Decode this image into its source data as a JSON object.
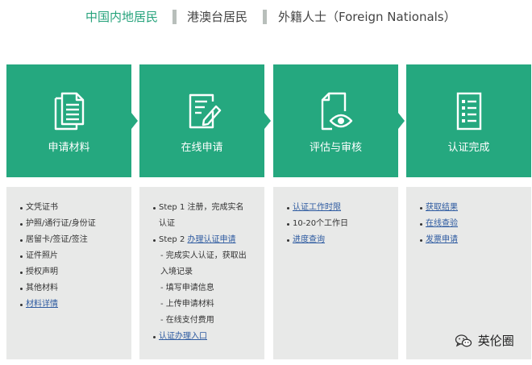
{
  "tabs": [
    {
      "label": "中国内地居民",
      "active": true
    },
    {
      "label": "港澳台居民",
      "active": false
    },
    {
      "label": "外籍人士（Foreign Nationals）",
      "active": false
    }
  ],
  "steps": [
    {
      "title": "申请材料",
      "icon": "documents-icon",
      "items": [
        {
          "text": "文凭证书",
          "type": "bullet"
        },
        {
          "text": "护照/通行证/身份证",
          "type": "bullet"
        },
        {
          "text": "居留卡/签证/签注",
          "type": "bullet"
        },
        {
          "text": "证件照片",
          "type": "bullet"
        },
        {
          "text": "授权声明",
          "type": "bullet"
        },
        {
          "text": "其他材料",
          "type": "bullet"
        },
        {
          "text": "材料详情",
          "type": "bullet",
          "link": true
        }
      ]
    },
    {
      "title": "在线申请",
      "icon": "form-edit-icon",
      "items": [
        {
          "text": "Step 1 注册，完成实名",
          "type": "bullet"
        },
        {
          "text": "认证",
          "type": "cont"
        },
        {
          "text": "Step 2 ",
          "link_text": "办理认证申请",
          "type": "bullet-mixed"
        },
        {
          "text": "- 完成实人认证，获取出",
          "type": "sub"
        },
        {
          "text": "入境记录",
          "type": "sub"
        },
        {
          "text": "- 填写申请信息",
          "type": "sub"
        },
        {
          "text": "- 上传申请材料",
          "type": "sub"
        },
        {
          "text": "- 在线支付费用",
          "type": "sub"
        },
        {
          "text": "认证办理入口",
          "type": "bullet",
          "link": true
        }
      ]
    },
    {
      "title": "评估与审核",
      "icon": "document-eye-icon",
      "items": [
        {
          "text": "认证工作时限",
          "type": "bullet",
          "link": true
        },
        {
          "text": "10-20个工作日",
          "type": "bullet"
        },
        {
          "text": "进度查询",
          "type": "bullet",
          "link": true
        }
      ]
    },
    {
      "title": "认证完成",
      "icon": "checklist-icon",
      "items": [
        {
          "text": "获取结果",
          "type": "bullet",
          "link": true
        },
        {
          "text": "在线查验",
          "type": "bullet",
          "link": true
        },
        {
          "text": "发票申请",
          "type": "bullet",
          "link": true
        }
      ]
    }
  ],
  "watermark": {
    "text": "英伦圈",
    "icon": "wechat-icon"
  },
  "colors": {
    "accent": "#25a87f",
    "link": "#2d5aa0",
    "panel_bg": "#e8e9e8"
  }
}
